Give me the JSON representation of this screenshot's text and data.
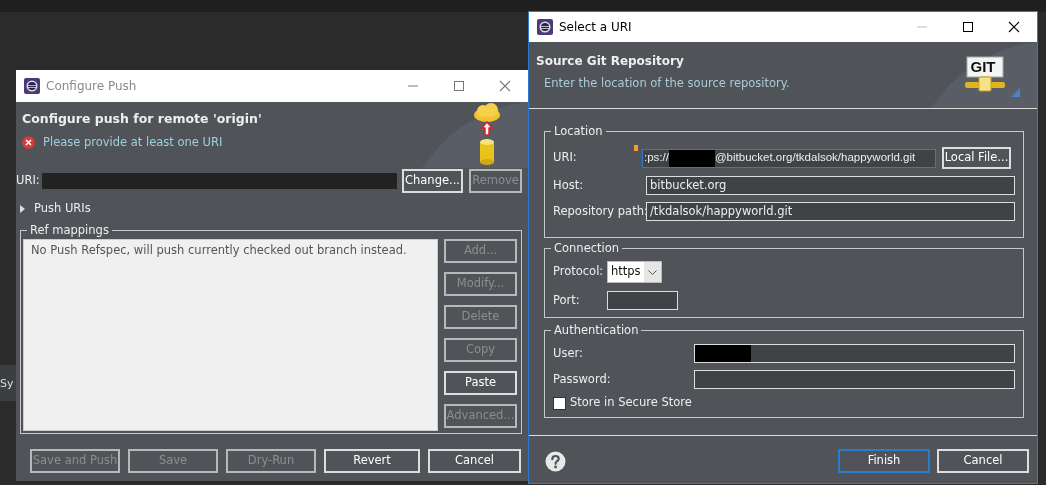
{
  "background": {
    "fragments": [
      "Sy"
    ]
  },
  "configure_push": {
    "title": "Configure Push",
    "active": false,
    "heading": "Configure push for remote 'origin'",
    "error": "Please provide at least one URI",
    "uri_label": "URI:",
    "uri_buttons": [
      {
        "label": "Change...",
        "disabled": false
      },
      {
        "label": "Remove",
        "disabled": true
      }
    ],
    "push_uris": {
      "label": "Push URIs",
      "expanded": false
    },
    "ref_mappings": {
      "legend": "Ref mappings",
      "message": "No Push Refspec, will push currently checked out branch instead.",
      "buttons": [
        {
          "label": "Add...",
          "disabled": true
        },
        {
          "label": "Modify...",
          "disabled": true
        },
        {
          "label": "Delete",
          "disabled": true
        },
        {
          "label": "Copy",
          "disabled": true
        },
        {
          "label": "Paste",
          "disabled": false
        },
        {
          "label": "Advanced...",
          "disabled": true
        }
      ]
    },
    "footer_buttons": [
      {
        "label": "Save and Push",
        "disabled": true
      },
      {
        "label": "Save",
        "disabled": true
      },
      {
        "label": "Dry-Run",
        "disabled": true
      },
      {
        "label": "Revert",
        "disabled": false
      },
      {
        "label": "Cancel",
        "disabled": false
      }
    ]
  },
  "select_uri": {
    "title": "Select a URI",
    "active": true,
    "heading": "Source Git Repository",
    "description": "Enter the location of the source repository.",
    "logo_text": "GIT",
    "location": {
      "legend": "Location",
      "uri": {
        "label": "URI:",
        "value_start": ":ps://",
        "value_end": "@bitbucket.org/tkdalsok/happyworld.git"
      },
      "local_file_button": "Local File...",
      "host": {
        "label": "Host:",
        "value": "bitbucket.org"
      },
      "repository_path": {
        "label": "Repository path:",
        "value": "/tkdalsok/happyworld.git"
      }
    },
    "connection": {
      "legend": "Connection",
      "protocol": {
        "label": "Protocol:",
        "value": "https"
      },
      "port": {
        "label": "Port:"
      }
    },
    "authentication": {
      "legend": "Authentication",
      "user": {
        "label": "User:"
      },
      "password": {
        "label": "Password:"
      },
      "store": {
        "label": "Store in Secure Store",
        "checked": false
      }
    },
    "buttons": [
      {
        "label": "Finish",
        "default": true
      },
      {
        "label": "Cancel",
        "default": false
      }
    ]
  }
}
